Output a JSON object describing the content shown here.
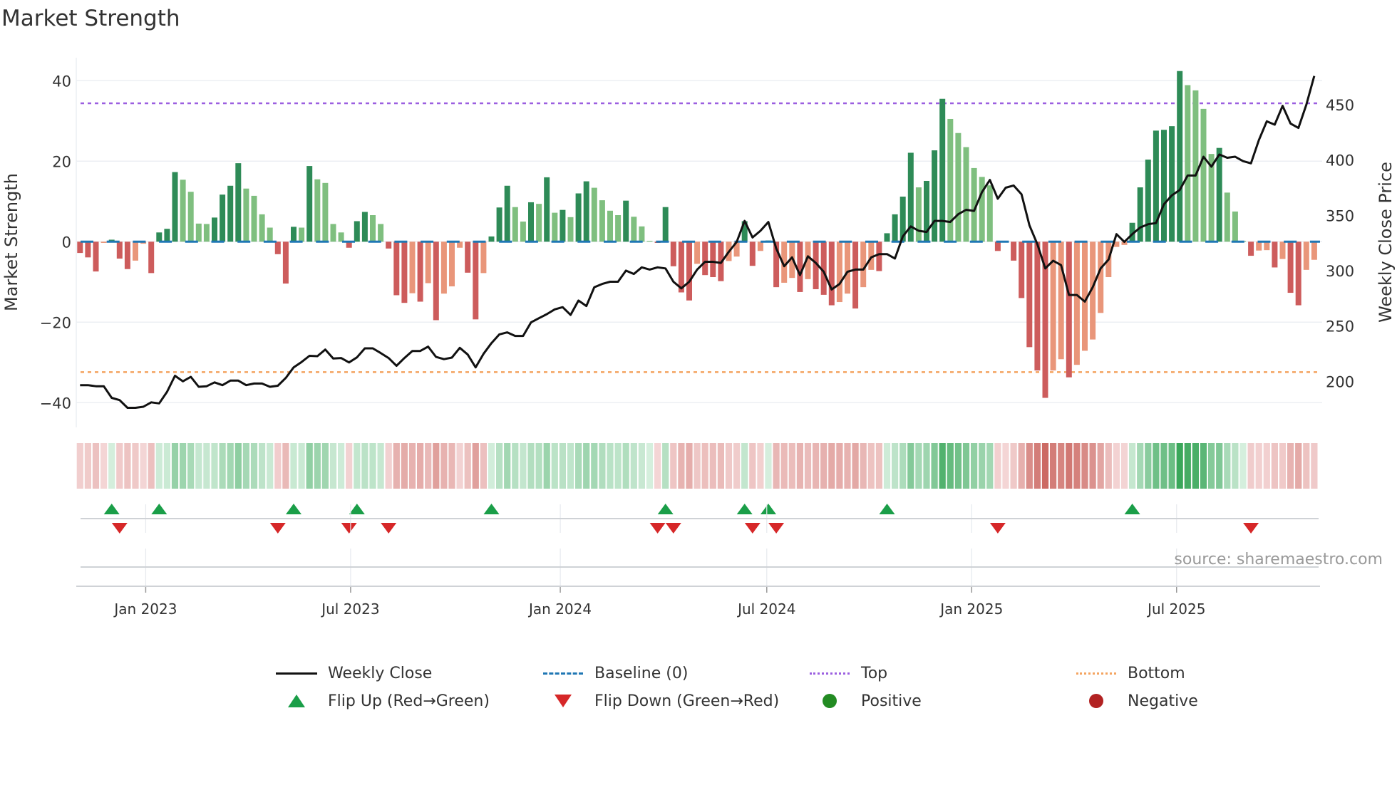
{
  "title": "Market Strength",
  "source": "source: sharemaestro.com",
  "legend": {
    "weekly_close": "Weekly Close",
    "baseline": "Baseline (0)",
    "top": "Top",
    "bottom": "Bottom",
    "flip_up": "Flip Up (Red→Green)",
    "flip_down": "Flip Down (Green→Red)",
    "positive": "Positive",
    "negative": "Negative"
  },
  "colors": {
    "bar_up_strong": "#2e8b57",
    "bar_up_weak": "#7fbf7f",
    "bar_down_strong": "#cd5c5c",
    "bar_down_weak": "#e9967a",
    "baseline": "#1f77b4",
    "top": "#9b5fe0",
    "bottom": "#f4a460",
    "close": "#111111",
    "flip_up": "#1a9e48",
    "flip_down": "#d62728",
    "positive": "#228b22",
    "negative": "#b22222"
  },
  "chart_data": {
    "type": "bar",
    "title": "Market Strength",
    "ylabel": "Market Strength",
    "y2label": "Weekly Close Price",
    "ylim": [
      -45,
      45
    ],
    "y2lim": [
      165,
      480
    ],
    "yticks": [
      40,
      20,
      0,
      -20,
      -40
    ],
    "yticklabels": [
      "40",
      "20",
      "0",
      "−20",
      "−40"
    ],
    "y2ticks": [
      200,
      250,
      300,
      350,
      400,
      450
    ],
    "y2ticklabels": [
      "200",
      "250",
      "300",
      "350",
      "400",
      "450"
    ],
    "xtick_weeks": [
      9.3,
      35.2,
      61.7,
      87.8,
      113.7,
      139.6
    ],
    "xticklabels": [
      "Jan 2023",
      "Jul 2023",
      "Jan 2024",
      "Jul 2024",
      "Jan 2025",
      "Jul 2025"
    ],
    "grid": true,
    "legend_position": "bottom",
    "top_level": 34.4,
    "bottom_level": -32.4,
    "baseline": 0,
    "series": [
      {
        "name": "Market Strength",
        "type": "bar",
        "values": [
          -2.8,
          -3.9,
          -7.4,
          -0.3,
          0.5,
          -4.2,
          -6.8,
          -4.7,
          -0.5,
          -7.8,
          2.3,
          3.2,
          17.3,
          15.4,
          12.4,
          4.5,
          4.4,
          6.0,
          11.7,
          13.9,
          19.5,
          13.2,
          11.4,
          6.8,
          3.5,
          -3.1,
          -10.4,
          3.7,
          3.5,
          18.8,
          15.5,
          14.6,
          4.4,
          2.3,
          -1.5,
          5.1,
          7.4,
          6.6,
          4.4,
          -1.7,
          -13.3,
          -15.2,
          -12.8,
          -14.9,
          -10.3,
          -19.5,
          -12.9,
          -11.1,
          -1.5,
          -7.7,
          -19.3,
          -7.8,
          1.3,
          8.5,
          13.9,
          8.6,
          5.0,
          9.8,
          9.4,
          16.0,
          7.2,
          7.9,
          6.1,
          12.0,
          15.0,
          13.4,
          10.3,
          7.7,
          6.6,
          10.2,
          6.2,
          3.8,
          0.2,
          -0.3,
          8.6,
          -6.1,
          -12.6,
          -14.6,
          -5.5,
          -8.3,
          -8.8,
          -9.8,
          -4.8,
          -3.7,
          5.1,
          -6.0,
          -2.3,
          0.3,
          -11.3,
          -10.2,
          -9.0,
          -12.5,
          -9.3,
          -11.8,
          -13.2,
          -15.8,
          -15.0,
          -12.9,
          -16.6,
          -11.3,
          -7.0,
          -7.3,
          2.1,
          6.8,
          11.2,
          22.1,
          13.5,
          15.1,
          22.7,
          35.5,
          30.5,
          27.0,
          23.5,
          18.3,
          16.1,
          14.0,
          -2.3,
          -0.2,
          -4.7,
          -14.0,
          -26.2,
          -32.0,
          -38.8,
          -32.0,
          -29.2,
          -33.7,
          -30.6,
          -27.1,
          -24.3,
          -17.7,
          -8.8,
          -1.3,
          -0.8,
          4.7,
          13.5,
          20.4,
          27.6,
          27.8,
          28.7,
          42.4,
          38.9,
          37.6,
          33.0,
          21.8,
          23.3,
          12.2,
          7.5,
          0.2,
          -3.5,
          -2.2,
          -2.1,
          -6.4,
          -4.3,
          -12.7,
          -15.8,
          -7.0,
          -4.5
        ]
      },
      {
        "name": "Weekly Close",
        "type": "line",
        "axis": "y2",
        "values": [
          196.5,
          196.5,
          195.5,
          195.5,
          185,
          183,
          176,
          176,
          177,
          181,
          180,
          190.5,
          205,
          200,
          204,
          195,
          195.5,
          199,
          196.5,
          200.6,
          200.6,
          196.5,
          198,
          198,
          195,
          196,
          203,
          212.6,
          217.4,
          223,
          222.7,
          228.7,
          220.6,
          221,
          217,
          221.6,
          229.8,
          229.8,
          225.5,
          221,
          214,
          221,
          227.4,
          227.4,
          231.3,
          222,
          220,
          221.4,
          230.2,
          224.2,
          212.6,
          224.8,
          234.5,
          242.4,
          244.2,
          241,
          241,
          253.2,
          257,
          260.7,
          265,
          267,
          260,
          273,
          268,
          285,
          288,
          290,
          290,
          300,
          297,
          303,
          301,
          303,
          302,
          290,
          284,
          290,
          301,
          308,
          308,
          307,
          317,
          326,
          345,
          330,
          336,
          344,
          320,
          304,
          312,
          296,
          313,
          307,
          299,
          283,
          288,
          299,
          301,
          301,
          312,
          315,
          315,
          311,
          331,
          340,
          336,
          335,
          345,
          345,
          344,
          351,
          355,
          354,
          371,
          382,
          365,
          375,
          377,
          369,
          341,
          324,
          302,
          309,
          305,
          278,
          278,
          272,
          285,
          302,
          310,
          333,
          326,
          333,
          339,
          342,
          343,
          360,
          368,
          373,
          386,
          386,
          403,
          394,
          405,
          402,
          403,
          399,
          397,
          418,
          435,
          432,
          449,
          433,
          429,
          450,
          476
        ]
      }
    ]
  }
}
